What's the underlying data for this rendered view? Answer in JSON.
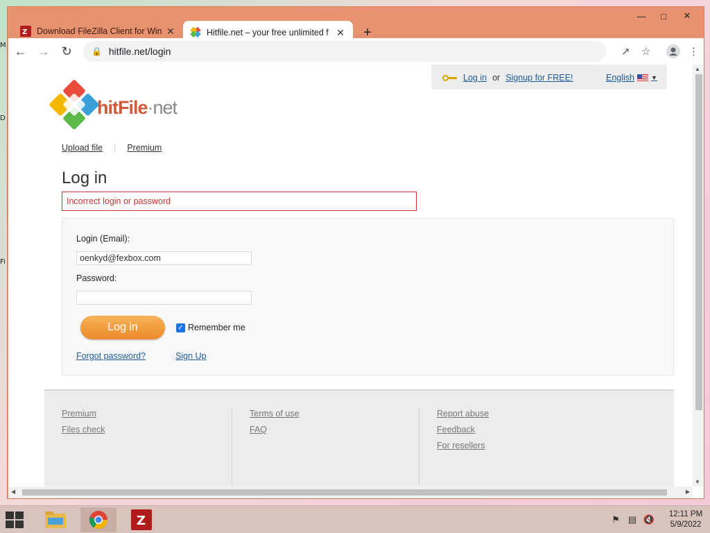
{
  "desktop": {
    "icon_labels": [
      "M",
      "D",
      "Fi"
    ]
  },
  "tabs": [
    {
      "title": "Download FileZilla Client for Win",
      "active": false,
      "favicon": "filezilla-icon"
    },
    {
      "title": "Hitfile.net – your free unlimited f",
      "active": true,
      "favicon": "hitfile-icon"
    }
  ],
  "toolbar": {
    "url": "hitfile.net/login"
  },
  "header": {
    "login_label": "Log in",
    "or_label": "or",
    "signup_label": "Signup for FREE!",
    "language_label": "English"
  },
  "logo": {
    "name": "hitFile",
    "suffix": "net"
  },
  "site_nav": {
    "upload_label": "Upload file",
    "premium_label": "Premium"
  },
  "main": {
    "title": "Log in",
    "error": "Incorrect login or password",
    "login_label": "Login (Email):",
    "login_value": "oenkyd@fexbox.com",
    "password_label": "Password:",
    "password_value": "",
    "submit_label": "Log in",
    "remember_label": "Remember me",
    "remember_checked": true,
    "forgot_label": "Forgot password?",
    "signup_label": "Sign Up"
  },
  "footer": {
    "col1": [
      "Premium",
      "Files check"
    ],
    "col2": [
      "Terms of use",
      "FAQ"
    ],
    "col3": [
      "Report abuse",
      "Feedback",
      "For resellers"
    ]
  },
  "taskbar": {
    "time": "12:11 PM",
    "date": "5/9/2022"
  },
  "colors": {
    "titlebar": "#e9926f",
    "accent_orange": "#ec8a2a",
    "error_red": "#cc3333",
    "link_blue": "#1a5a9b"
  }
}
